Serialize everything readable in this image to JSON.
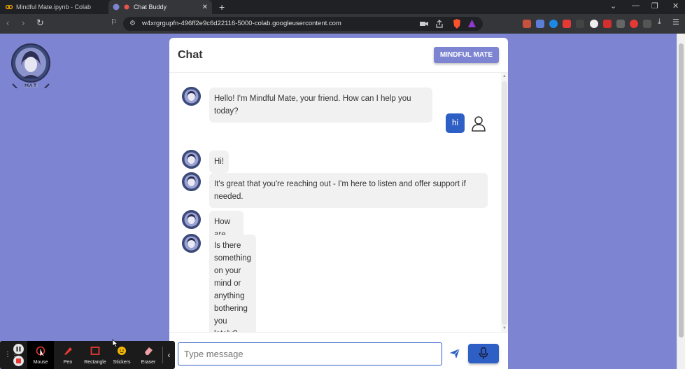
{
  "browser": {
    "tabs": [
      {
        "label": "Mindful Mate.ipynb - Colab",
        "active": false
      },
      {
        "label": "Chat Buddy",
        "active": true
      }
    ],
    "url": "w4xrgrgupfn-496ff2e9c6d22116-5000-colab.googleusercontent.com"
  },
  "chat": {
    "title": "Chat",
    "header_button": "MINDFUL MATE",
    "messages": [
      {
        "sender": "bot",
        "text": "Hello! I'm Mindful Mate, your friend. How can I help you today?"
      },
      {
        "sender": "user",
        "text": "hi"
      },
      {
        "sender": "bot",
        "text": "Hi!"
      },
      {
        "sender": "bot",
        "text": "It's great that you're reaching out - I'm here to listen and offer support if needed."
      },
      {
        "sender": "bot",
        "text": "How are things going?"
      },
      {
        "sender": "bot",
        "text": "Is there something on your mind or anything bothering you lately?"
      }
    ],
    "input_placeholder": "Type message"
  },
  "recorder": {
    "tools": [
      "Mouse",
      "Pen",
      "Rectangle",
      "Stickers",
      "Eraser"
    ],
    "selected_tool": "Mouse"
  },
  "colors": {
    "page_bg": "#7d84d2",
    "accent": "#2e5fc4",
    "bot_bubble": "#f1f1f1"
  }
}
